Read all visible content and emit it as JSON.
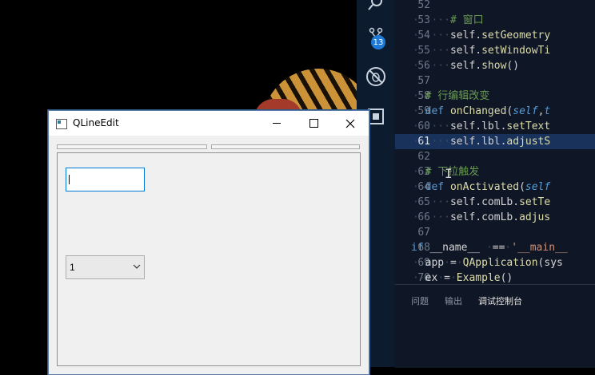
{
  "qt_window": {
    "title": "QLineEdit",
    "line_edit": {
      "value": ""
    },
    "combo": {
      "selected": "1"
    }
  },
  "vscode": {
    "badge_count": "13",
    "lines": [
      {
        "num": "52",
        "html": ""
      },
      {
        "num": "53",
        "html": "<span class='dots'>······</span><span class='cm'># 窗口</span>"
      },
      {
        "num": "54",
        "html": "<span class='dots'>······</span>self.<span class='fn'>setGeometry</span>"
      },
      {
        "num": "55",
        "html": "<span class='dots'>······</span>self.<span class='fn'>setWindowTi</span>"
      },
      {
        "num": "56",
        "html": "<span class='dots'>······</span>self.<span class='fn'>show</span>()"
      },
      {
        "num": "57",
        "html": ""
      },
      {
        "num": "58",
        "html": "<span class='dots'>··</span><span class='cm'># 行编辑改变</span>"
      },
      {
        "num": "59",
        "html": "<span class='dots'>··</span><span class='kw'>def</span> <span class='fn'>onChanged</span>(<span class='sf'>self</span>,<span class='sf'>t</span>"
      },
      {
        "num": "60",
        "html": "<span class='dots'>······</span>self.lbl.<span class='fn'>setText</span>"
      },
      {
        "num": "61",
        "html": "<span class='dots'>······</span>self.lbl.<span class='fn'>adjustS</span>"
      },
      {
        "num": "62",
        "html": ""
      },
      {
        "num": "63",
        "html": "<span class='dots'>··</span><span class='cm'># 下拉触发</span>"
      },
      {
        "num": "64",
        "html": "<span class='dots'>··</span><span class='kw'>def</span> <span class='fn'>onActivated</span>(<span class='sf'>self</span>"
      },
      {
        "num": "65",
        "html": "<span class='dots'>······</span>self.comLb.<span class='fn'>setTe</span>"
      },
      {
        "num": "66",
        "html": "<span class='dots'>······</span>self.comLb.<span class='fn'>adjus</span>"
      },
      {
        "num": "67",
        "html": ""
      },
      {
        "num": "68",
        "html": "<span class='kw'>if</span> __name__ <span class='dots'>·</span>==<span class='dots'>·</span><span class='st'>'__main__</span>"
      },
      {
        "num": "69",
        "html": "<span class='dots'>··</span>app<span class='dots'>·</span>=<span class='dots'>·</span><span class='fn'>QApplication</span>(sys"
      },
      {
        "num": "70",
        "html": "<span class='dots'>··</span>ex<span class='dots'>·</span>=<span class='dots'>·</span><span class='fn'>Example</span>()"
      }
    ],
    "active_line": "61",
    "panel_tabs": [
      "问题",
      "输出",
      "调试控制台"
    ],
    "active_panel_tab": "调试控制台"
  }
}
